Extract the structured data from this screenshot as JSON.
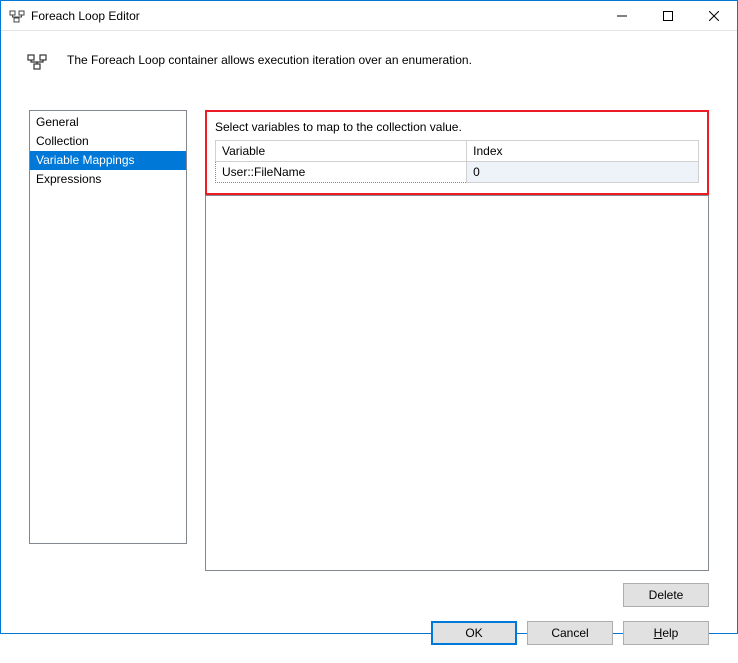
{
  "window": {
    "title": "Foreach Loop Editor"
  },
  "description": "The Foreach Loop container allows execution iteration over an enumeration.",
  "nav": {
    "items": [
      {
        "label": "General",
        "selected": false
      },
      {
        "label": "Collection",
        "selected": false
      },
      {
        "label": "Variable Mappings",
        "selected": true
      },
      {
        "label": "Expressions",
        "selected": false
      }
    ]
  },
  "content": {
    "instruction": "Select variables to map to the collection value.",
    "columns": {
      "variable": "Variable",
      "index": "Index"
    },
    "rows": [
      {
        "variable": "User::FileName",
        "index": "0"
      }
    ]
  },
  "buttons": {
    "delete": "Delete",
    "ok": "OK",
    "cancel": "Cancel",
    "help_prefix": "H",
    "help_rest": "elp"
  }
}
